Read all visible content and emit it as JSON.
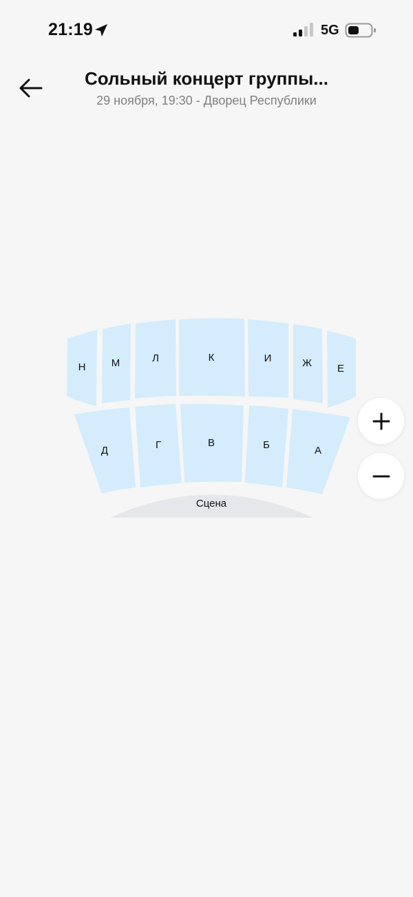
{
  "status_bar": {
    "time": "21:19",
    "network": "5G",
    "icons": [
      "location-arrow-icon",
      "signal-icon",
      "battery-icon"
    ]
  },
  "header": {
    "back_icon": "arrow-left-icon",
    "title": "Сольный концерт группы...",
    "subtitle": "29 ноября, 19:30 - Дворец Республики"
  },
  "hall": {
    "sector_color": "#d4ecfc",
    "stage_color": "#e6e7ea",
    "sectors_top": [
      "Н",
      "М",
      "Л",
      "К",
      "И",
      "Ж",
      "Е"
    ],
    "sectors_bottom": [
      "Д",
      "Г",
      "В",
      "Б",
      "А"
    ],
    "stage_label": "Сцена"
  },
  "zoom": {
    "in_icon": "plus-icon",
    "out_icon": "minus-icon"
  }
}
